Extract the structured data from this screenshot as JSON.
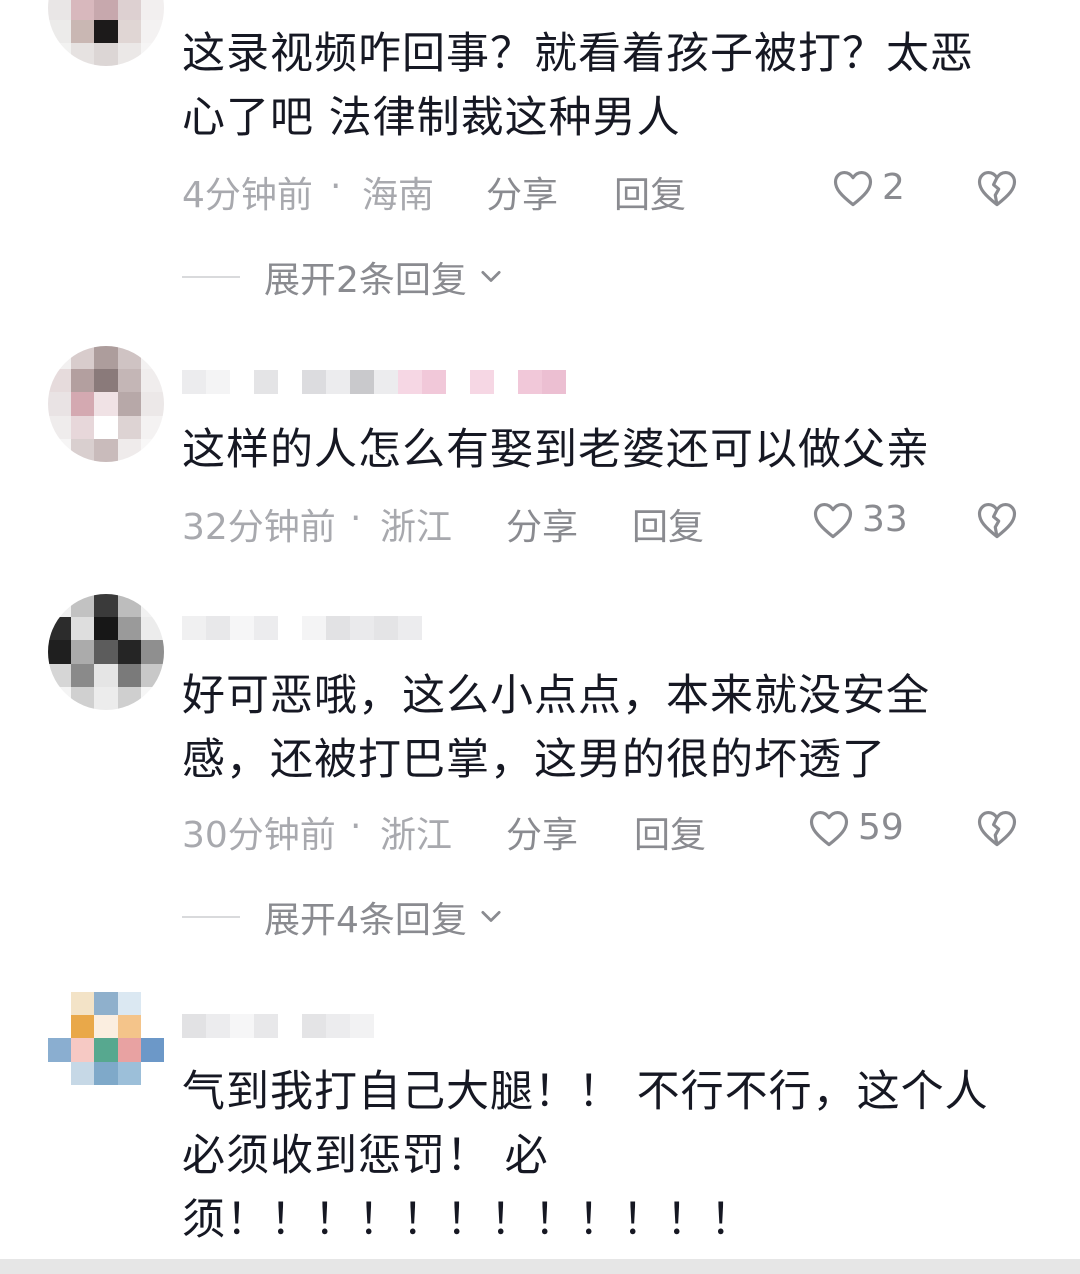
{
  "comments": [
    {
      "username": "",
      "text": "这录视频咋回事？就看着孩子被打？太恶心了吧 法律制裁这种男人",
      "time": "4分钟前",
      "location": "海南",
      "share_label": "分享",
      "reply_label": "回复",
      "likes": "2",
      "expand_label": "展开2条回复"
    },
    {
      "username": "",
      "text": "这样的人怎么有娶到老婆还可以做父亲",
      "time": "32分钟前",
      "location": "浙江",
      "share_label": "分享",
      "reply_label": "回复",
      "likes": "33"
    },
    {
      "username": "",
      "text": "好可恶哦，这么小点点，本来就没安全感，还被打巴掌，这男的很的坏透了",
      "time": "30分钟前",
      "location": "浙江",
      "share_label": "分享",
      "reply_label": "回复",
      "likes": "59",
      "expand_label": "展开4条回复"
    },
    {
      "username": "",
      "text": "气到我打自己大腿！！ 不行不行，这个人必须收到惩罚！ 必\n须！！！！！！！！！！！！",
      "time": "",
      "location": ""
    }
  ],
  "separator": "·",
  "colors": {
    "text": "#161823",
    "meta": "#a8a9ae",
    "action": "#8a8b90",
    "background": "#ffffff"
  },
  "icons": {
    "like": "heart-outline-icon",
    "dislike": "broken-heart-icon",
    "expand": "chevron-down-icon"
  }
}
